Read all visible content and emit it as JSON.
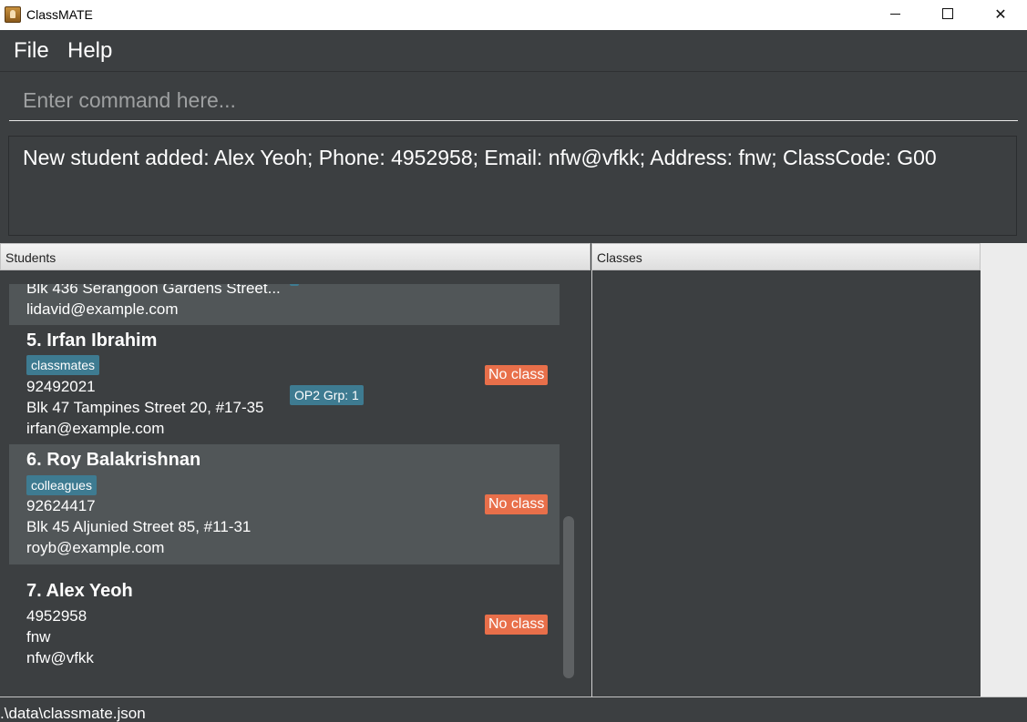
{
  "window": {
    "title": "ClassMATE",
    "minimize_icon": "minimize-icon",
    "maximize_icon": "maximize-icon",
    "close_icon": "close-icon",
    "close_glyph": "✕"
  },
  "menu": {
    "file": "File",
    "help": "Help"
  },
  "command": {
    "placeholder": "Enter command here...",
    "value": ""
  },
  "result": {
    "text": "New student added: Alex Yeoh; Phone: 4952958; Email: nfw@vfkk; Address: fnw; ClassCode: G00"
  },
  "panels": {
    "students_title": "Students",
    "classes_title": "Classes"
  },
  "students": [
    {
      "address": "Blk 436 Serangoon Gardens Street...",
      "email": "lidavid@example.com"
    },
    {
      "index_name": "5.  Irfan Ibrahim",
      "tag": "classmates",
      "phone": "92492021",
      "address": "Blk 47 Tampines Street 20, #17-35",
      "email": "irfan@example.com",
      "class_label": "OP2 Grp: 1",
      "status": "No class"
    },
    {
      "index_name": "6.  Roy Balakrishnan",
      "tag": "colleagues",
      "phone": "92624417",
      "address": "Blk 45 Aljunied Street 85, #11-31",
      "email": "royb@example.com",
      "status": "No class"
    },
    {
      "index_name": "7.  Alex Yeoh",
      "phone": "4952958",
      "address": "fnw",
      "email": "nfw@vfkk",
      "status": "No class"
    }
  ],
  "statusbar": {
    "path": ".\\data\\classmate.json"
  },
  "colors": {
    "background": "#3c3f41",
    "card_alt": "#515658",
    "tag": "#3e7b91",
    "no_class": "#e86f4a"
  }
}
